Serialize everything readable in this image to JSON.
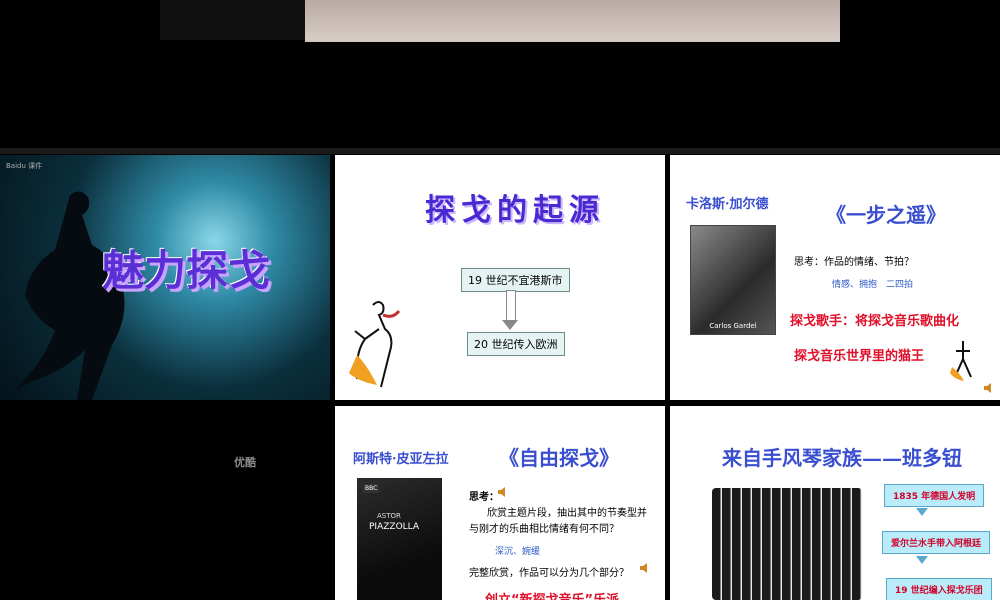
{
  "slides": {
    "s1": {
      "watermark": "Baidu 课件",
      "title": "魅力探戈"
    },
    "s2": {
      "title": "探戈的起源",
      "box1": "19 世纪不宜港斯市",
      "box2": "20 世纪传入欧洲"
    },
    "s3": {
      "author": "卡洛斯·加尔德",
      "title": "《一步之遥》",
      "photo_caption": "Carlos Gardel",
      "q": "思考：作品的情绪、节拍？",
      "ans": "情感、拥抱　二四拍",
      "red1": "探戈歌手：将探戈音乐歌曲化",
      "red2": "探戈音乐世界里的猫王"
    },
    "s4": {
      "label": "优酷"
    },
    "s5": {
      "author": "阿斯特·皮亚左拉",
      "title": "《自由探戈》",
      "cd_line1": "ASTOR",
      "cd_line2": "PIAZZOLLA",
      "cd_brand": "BBC",
      "think": "思考：",
      "q1": "欣赏主题片段，抽出其中的节奏型并与刚才的乐曲相比情绪有何不同？",
      "hint": "深沉、婉缓",
      "q2": "完整欣赏，作品可以分为几个部分？",
      "red": "创立“新探戈音乐”乐派"
    },
    "s6": {
      "title": "来自手风琴家族——班多钮",
      "b1": "1835 年德国人发明",
      "b2": "爱尔兰水手带入阿根廷",
      "b3": "19 世纪编入探戈乐团"
    }
  },
  "colors": {
    "title_purple": "#5b2fd6",
    "red": "#e0102a",
    "blue": "#3a4fd0"
  }
}
